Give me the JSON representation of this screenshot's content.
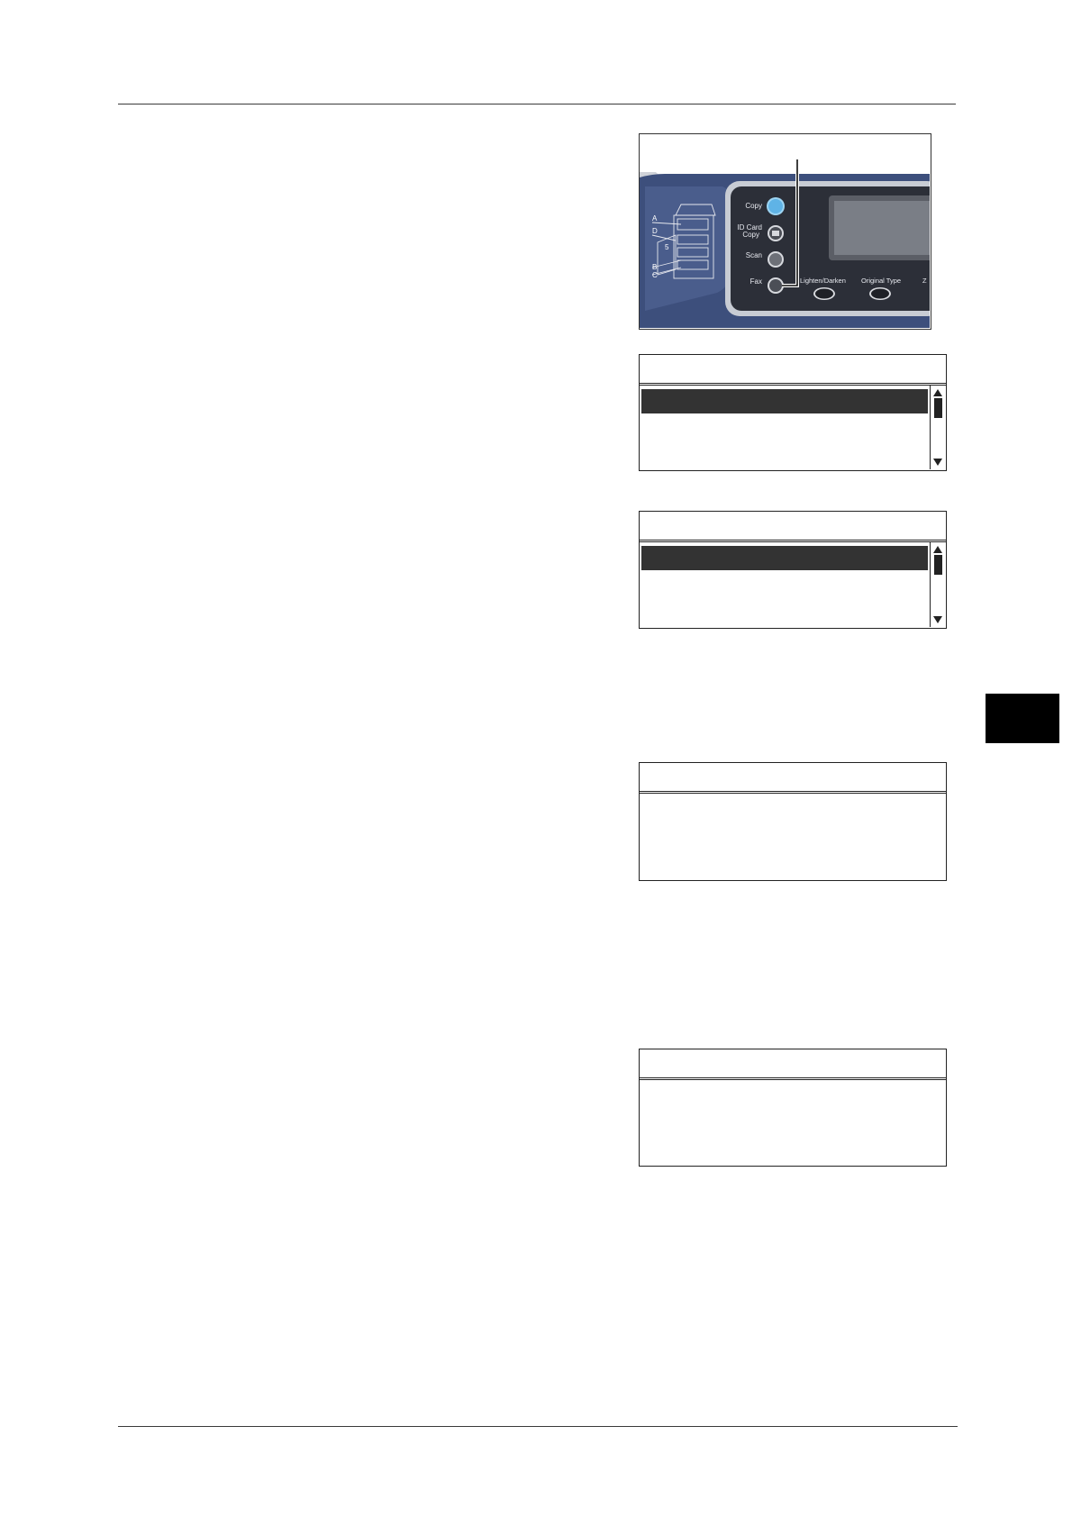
{
  "panel": {
    "copy_label": "Copy",
    "id_card_label_1": "ID Card",
    "id_card_label_2": "Copy",
    "scan_label": "Scan",
    "fax_label": "Fax",
    "lighten_darken_label": "Lighten/Darken",
    "original_type_label": "Original Type",
    "partial_label": "Z",
    "device_markers": {
      "a": "A",
      "b": "B",
      "c": "C",
      "d": "D",
      "num_5": "5"
    },
    "colors": {
      "panel_blue": "#3d4f7c",
      "copy_button": "#5fb3e6",
      "bezel": "#2c2f38"
    }
  },
  "lcd_screens": [
    {
      "title": "",
      "rows": [
        "",
        "",
        ""
      ],
      "selected_index": 0,
      "scrollbar": true
    },
    {
      "title": "",
      "rows": [
        "",
        "",
        ""
      ],
      "selected_index": 0,
      "scrollbar": true
    },
    {
      "title": "",
      "rows": [],
      "scrollbar": false
    },
    {
      "title": "",
      "rows": [],
      "scrollbar": false
    }
  ]
}
